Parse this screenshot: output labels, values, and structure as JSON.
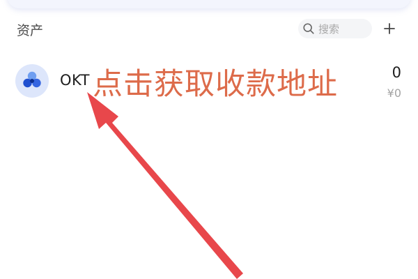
{
  "assets": {
    "title": "资产",
    "search": {
      "placeholder": "搜索",
      "icon": "search-icon"
    },
    "add": {
      "label": "+",
      "icon": "plus-icon"
    },
    "items": [
      {
        "symbol": "OKT",
        "balance": "0",
        "fiat_value": "¥0",
        "icon": "okt-token-icon"
      }
    ]
  },
  "annotation": {
    "text": "点击获取收款地址",
    "color": "#dd6b4a"
  },
  "colors": {
    "arrow": "#e8474b",
    "accent": "#3b6fe0",
    "avatar_bg": "#dde6fb"
  }
}
